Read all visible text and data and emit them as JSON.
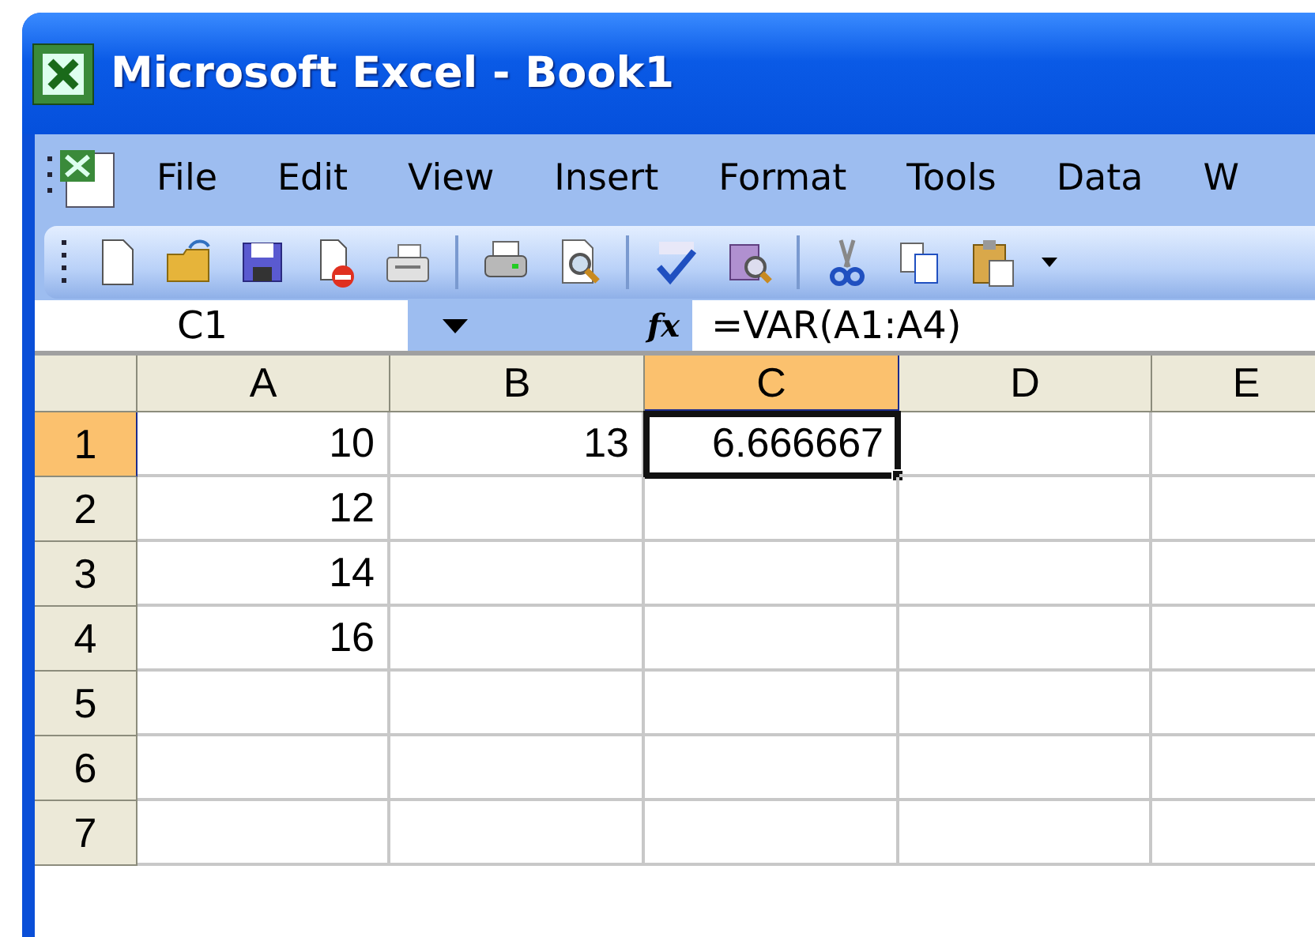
{
  "window": {
    "title": "Microsoft Excel - Book1"
  },
  "menu": [
    {
      "label": "File"
    },
    {
      "label": "Edit"
    },
    {
      "label": "View"
    },
    {
      "label": "Insert"
    },
    {
      "label": "Format"
    },
    {
      "label": "Tools"
    },
    {
      "label": "Data"
    },
    {
      "label": "W"
    }
  ],
  "formula_bar": {
    "name_box": "C1",
    "function_label": "fx",
    "formula": "=VAR(A1:A4)"
  },
  "sheet": {
    "columns": [
      {
        "label": "A",
        "selected": false
      },
      {
        "label": "B",
        "selected": false
      },
      {
        "label": "C",
        "selected": true
      },
      {
        "label": "D",
        "selected": false
      },
      {
        "label": "E",
        "selected": false
      }
    ],
    "rows": [
      {
        "label": "1",
        "selected": true,
        "cells": [
          {
            "value": "10",
            "selected": false
          },
          {
            "value": "13",
            "selected": false
          },
          {
            "value": "6.666667",
            "selected": true
          },
          {
            "selected": false
          },
          {
            "selected": false
          }
        ]
      },
      {
        "label": "2",
        "selected": false,
        "cells": [
          {
            "value": "12",
            "selected": false
          },
          {
            "selected": false
          },
          {
            "selected": false
          },
          {
            "selected": false
          },
          {
            "selected": false
          }
        ]
      },
      {
        "label": "3",
        "selected": false,
        "cells": [
          {
            "value": "14",
            "selected": false
          },
          {
            "selected": false
          },
          {
            "selected": false
          },
          {
            "selected": false
          },
          {
            "selected": false
          }
        ]
      },
      {
        "label": "4",
        "selected": false,
        "cells": [
          {
            "value": "16",
            "selected": false
          },
          {
            "selected": false
          },
          {
            "selected": false
          },
          {
            "selected": false
          },
          {
            "selected": false
          }
        ]
      },
      {
        "label": "5",
        "selected": false,
        "cells": [
          {
            "selected": false
          },
          {
            "selected": false
          },
          {
            "selected": false
          },
          {
            "selected": false
          },
          {
            "selected": false
          }
        ]
      },
      {
        "label": "6",
        "selected": false,
        "cells": [
          {
            "selected": false
          },
          {
            "selected": false
          },
          {
            "selected": false
          },
          {
            "selected": false
          },
          {
            "selected": false
          }
        ]
      },
      {
        "label": "7",
        "selected": false,
        "cells": [
          {
            "selected": false
          },
          {
            "selected": false
          },
          {
            "selected": false
          },
          {
            "selected": false
          },
          {
            "selected": false
          }
        ]
      }
    ]
  }
}
